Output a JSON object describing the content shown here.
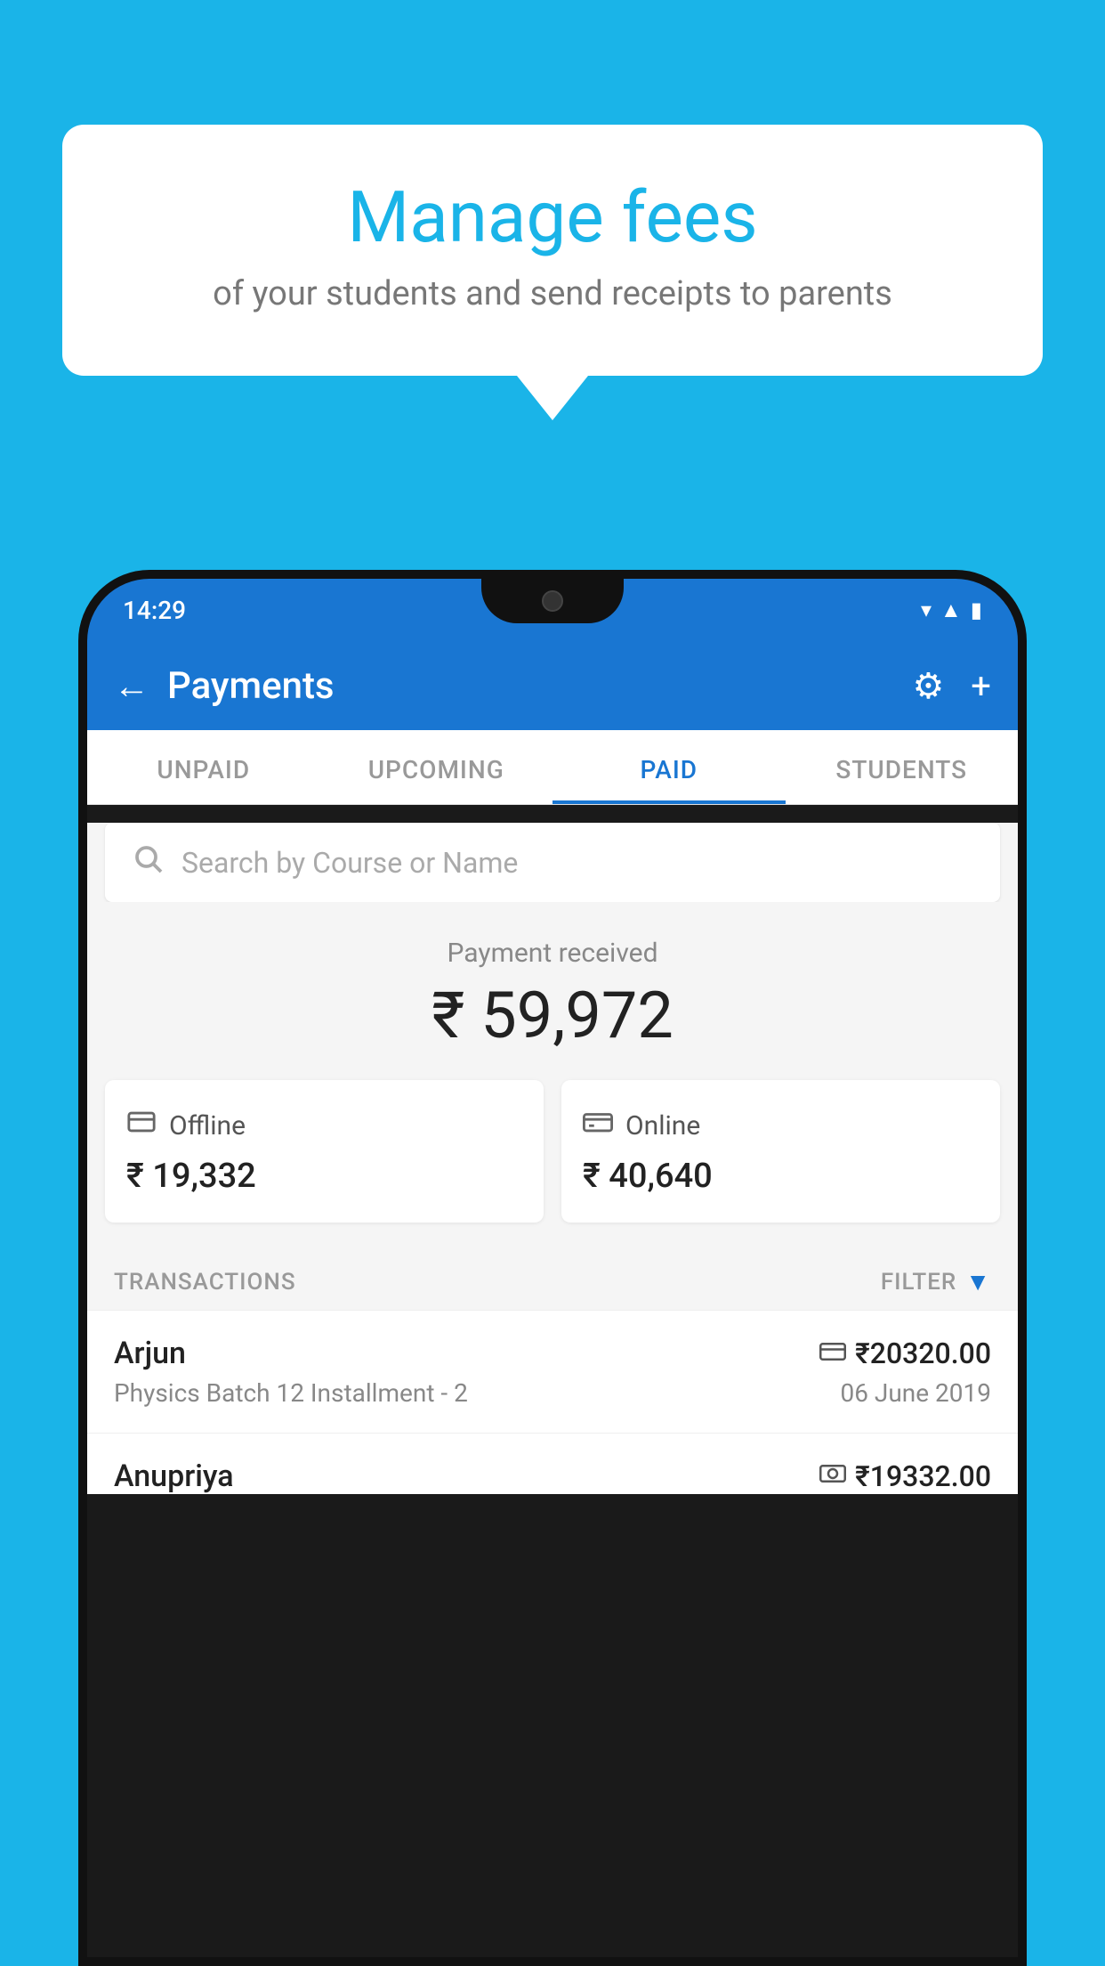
{
  "background_color": "#1ab4e8",
  "speech_bubble": {
    "title": "Manage fees",
    "subtitle": "of your students and send receipts to parents"
  },
  "phone": {
    "status_bar": {
      "time": "14:29",
      "icons": [
        "wifi",
        "signal",
        "battery"
      ]
    },
    "header": {
      "back_label": "←",
      "title": "Payments",
      "settings_icon": "⚙",
      "plus_icon": "+"
    },
    "tabs": [
      {
        "label": "UNPAID",
        "active": false
      },
      {
        "label": "UPCOMING",
        "active": false
      },
      {
        "label": "PAID",
        "active": true
      },
      {
        "label": "STUDENTS",
        "active": false
      }
    ],
    "search": {
      "placeholder": "Search by Course or Name"
    },
    "payment_received": {
      "label": "Payment received",
      "amount": "₹ 59,972"
    },
    "payment_cards": [
      {
        "type": "Offline",
        "amount": "₹ 19,332",
        "icon": "💳"
      },
      {
        "type": "Online",
        "amount": "₹ 40,640",
        "icon": "💳"
      }
    ],
    "transactions_label": "TRANSACTIONS",
    "filter_label": "FILTER",
    "transactions": [
      {
        "name": "Arjun",
        "amount": "₹20320.00",
        "course": "Physics Batch 12 Installment - 2",
        "date": "06 June 2019",
        "icon": "💳"
      },
      {
        "name": "Anupriya",
        "amount": "₹19332.00",
        "icon": "💵"
      }
    ]
  }
}
